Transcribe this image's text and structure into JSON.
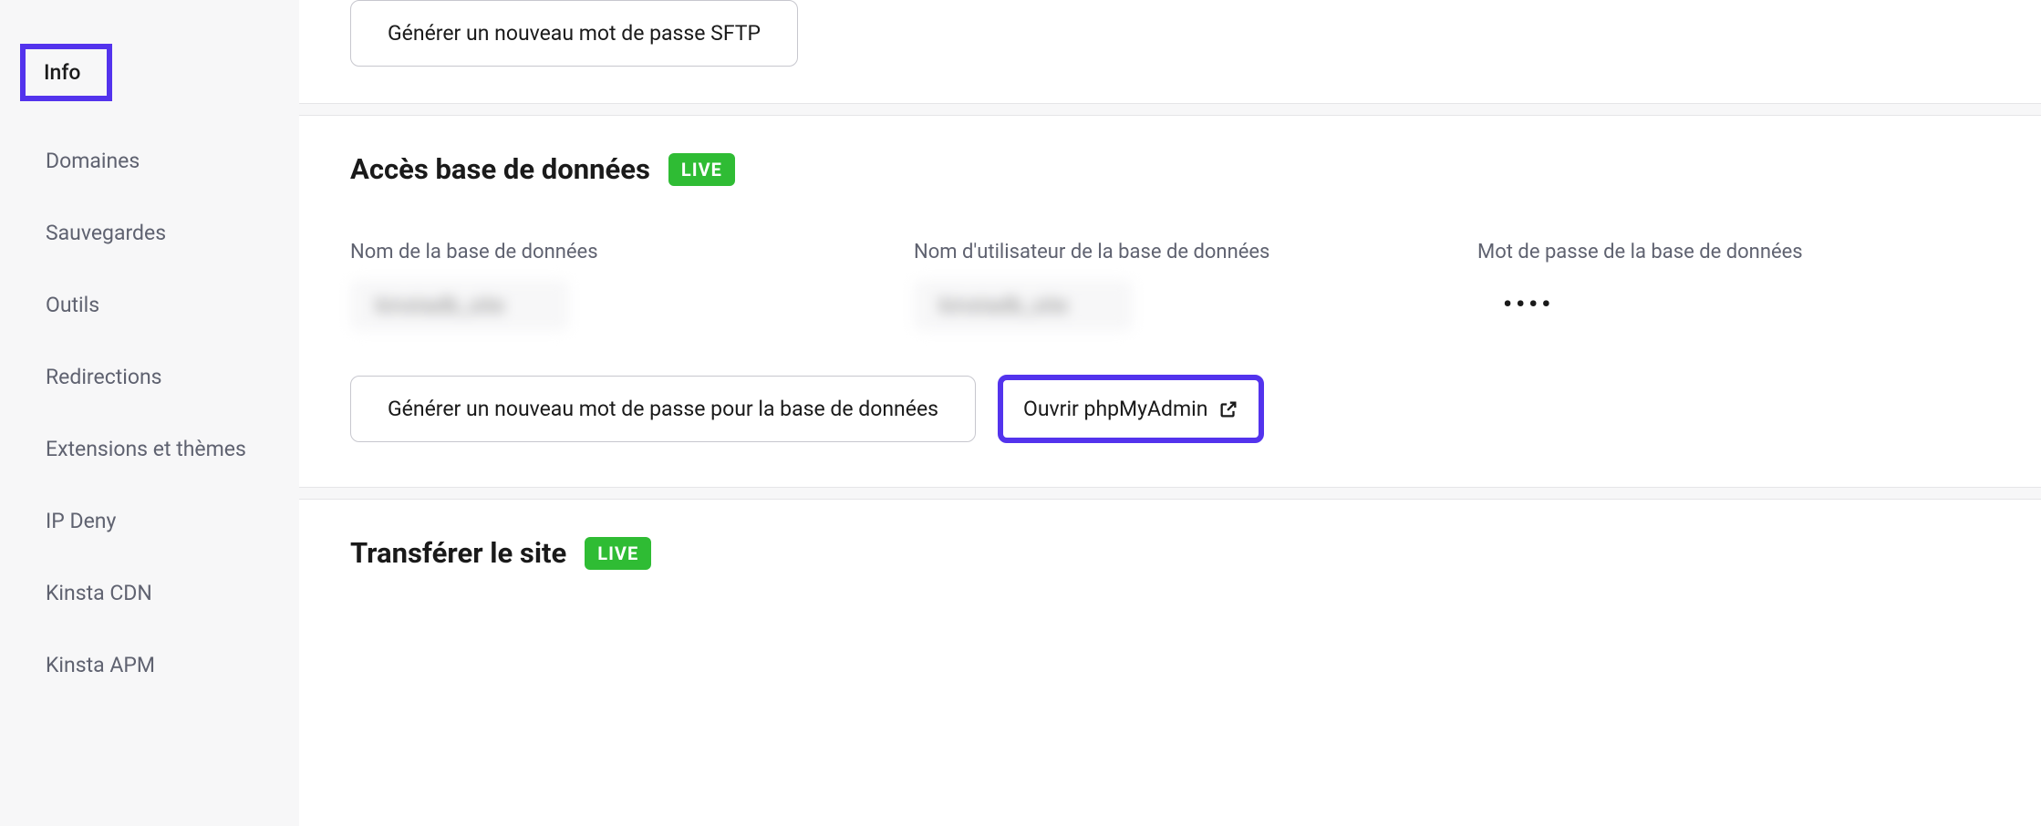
{
  "sidebar": {
    "items": [
      {
        "label": "Info",
        "active": true
      },
      {
        "label": "Domaines",
        "active": false
      },
      {
        "label": "Sauvegardes",
        "active": false
      },
      {
        "label": "Outils",
        "active": false
      },
      {
        "label": "Redirections",
        "active": false
      },
      {
        "label": "Extensions et thèmes",
        "active": false
      },
      {
        "label": "IP Deny",
        "active": false
      },
      {
        "label": "Kinsta CDN",
        "active": false
      },
      {
        "label": "Kinsta APM",
        "active": false
      }
    ]
  },
  "sections": {
    "sftp": {
      "generate_button": "Générer un nouveau mot de passe SFTP"
    },
    "database": {
      "title": "Accès base de données",
      "badge": "LIVE",
      "fields": {
        "name": {
          "label": "Nom de la base de données",
          "value": "kinstadb_site"
        },
        "username": {
          "label": "Nom d'utilisateur de la base de données",
          "value": "kinstadb_site"
        },
        "password": {
          "label": "Mot de passe de la base de données",
          "value": "••••"
        }
      },
      "generate_button": "Générer un nouveau mot de passe pour la base de données",
      "phpmyadmin_button": "Ouvrir phpMyAdmin"
    },
    "transfer": {
      "title": "Transférer le site",
      "badge": "LIVE"
    }
  }
}
